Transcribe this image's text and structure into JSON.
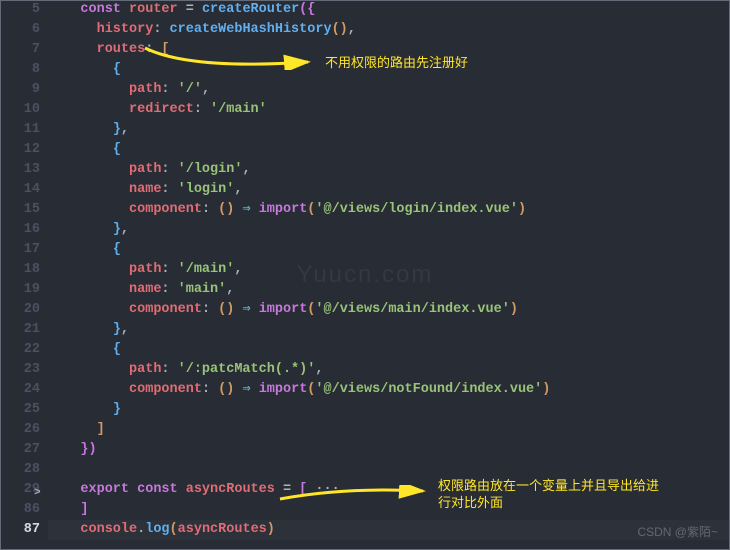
{
  "lineNumbers": [
    "5",
    "6",
    "7",
    "8",
    "9",
    "10",
    "11",
    "12",
    "13",
    "14",
    "15",
    "16",
    "17",
    "18",
    "19",
    "20",
    "21",
    "22",
    "23",
    "24",
    "25",
    "26",
    "27",
    "28",
    "29",
    "86",
    "87"
  ],
  "activeLine": "87",
  "annotations": {
    "a1": "不用权限的路由先注册好",
    "a2": "权限路由放在一个变量上并且导出给进行对比外面"
  },
  "watermark_center": "Yuucn.com",
  "watermark_br": "CSDN @紫陌~",
  "code": {
    "l5": {
      "indent": "    ",
      "kw": "const",
      "sp": " ",
      "decl": "router",
      "eq": " = ",
      "fn": "createRouter",
      "p": "({"
    },
    "l6": {
      "indent": "      ",
      "prop": "history",
      "col": ": ",
      "fn": "createWebHashHistory",
      "par": "()",
      "com": ","
    },
    "l7": {
      "indent": "      ",
      "prop": "routes",
      "col": ": ",
      "br": "["
    },
    "l8": {
      "indent": "        ",
      "c": "{"
    },
    "l9": {
      "indent": "          ",
      "prop": "path",
      "col": ": ",
      "str": "'/'",
      "com": ","
    },
    "l10": {
      "indent": "          ",
      "prop": "redirect",
      "col": ": ",
      "str": "'/main'"
    },
    "l11": {
      "indent": "        ",
      "c": "}",
      "com": ","
    },
    "l12": {
      "indent": "        ",
      "c": "{"
    },
    "l13": {
      "indent": "          ",
      "prop": "path",
      "col": ": ",
      "str": "'/login'",
      "com": ","
    },
    "l14": {
      "indent": "          ",
      "prop": "name",
      "col": ": ",
      "str": "'login'",
      "com": ","
    },
    "l15": {
      "indent": "          ",
      "prop": "component",
      "col": ": ",
      "p1": "()",
      "ar": " ⇒ ",
      "fn": "import",
      "p2": "(",
      "str": "'@/views/login/index.vue'",
      "p3": ")"
    },
    "l16": {
      "indent": "        ",
      "c": "}",
      "com": ","
    },
    "l17": {
      "indent": "        ",
      "c": "{"
    },
    "l18": {
      "indent": "          ",
      "prop": "path",
      "col": ": ",
      "str": "'/main'",
      "com": ","
    },
    "l19": {
      "indent": "          ",
      "prop": "name",
      "col": ": ",
      "str": "'main'",
      "com": ","
    },
    "l20": {
      "indent": "          ",
      "prop": "component",
      "col": ": ",
      "p1": "()",
      "ar": " ⇒ ",
      "fn": "import",
      "p2": "(",
      "str": "'@/views/main/index.vue'",
      "p3": ")"
    },
    "l21": {
      "indent": "        ",
      "c": "}",
      "com": ","
    },
    "l22": {
      "indent": "        ",
      "c": "{"
    },
    "l23": {
      "indent": "          ",
      "prop": "path",
      "col": ": ",
      "str": "'/:patcMatch(.*)'",
      "com": ","
    },
    "l24": {
      "indent": "          ",
      "prop": "component",
      "col": ": ",
      "p1": "()",
      "ar": " ⇒ ",
      "fn": "import",
      "p2": "(",
      "str": "'@/views/notFound/index.vue'",
      "p3": ")"
    },
    "l25": {
      "indent": "        ",
      "c": "}"
    },
    "l26": {
      "indent": "      ",
      "br": "]"
    },
    "l27": {
      "indent": "    ",
      "c": "})"
    },
    "l28": {
      "indent": ""
    },
    "l29": {
      "indent": "    ",
      "kw": "export const",
      "sp": " ",
      "decl": "asyncRoutes",
      "eq": " = ",
      "br": "[",
      "fold": " ···"
    },
    "l86": {
      "indent": "    ",
      "br": "]"
    },
    "l87": {
      "indent": "    ",
      "obj": "console",
      "dot": ".",
      "fn": "log",
      "p1": "(",
      "arg": "asyncRoutes",
      "p2": ")"
    }
  }
}
